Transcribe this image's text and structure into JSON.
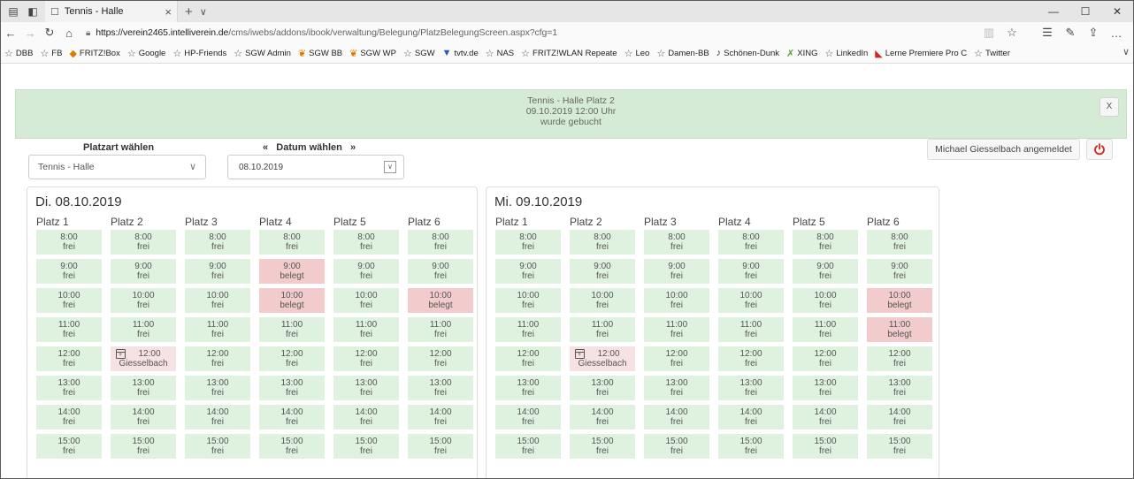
{
  "browser": {
    "tab_title": "Tennis - Halle",
    "url_host": "https://verein2465.intelliverein.de",
    "url_path": "/cms/iwebs/addons/ibook/verwaltung/Belegung/PlatzBelegungScreen.aspx?cfg=1",
    "favorites": [
      {
        "label": "DBB",
        "icon": "star-icon"
      },
      {
        "label": "FB",
        "icon": "star-icon"
      },
      {
        "label": "FRITZ!Box",
        "icon": "fritzbox-icon"
      },
      {
        "label": "Google",
        "icon": "star-icon"
      },
      {
        "label": "HP-Friends",
        "icon": "star-icon"
      },
      {
        "label": "SGW Admin",
        "icon": "star-icon"
      },
      {
        "label": "SGW BB",
        "icon": "sgw-icon"
      },
      {
        "label": "SGW WP",
        "icon": "sgw-icon"
      },
      {
        "label": "SGW",
        "icon": "star-icon"
      },
      {
        "label": "tvtv.de",
        "icon": "tvtv-icon"
      },
      {
        "label": "NAS",
        "icon": "star-icon"
      },
      {
        "label": "FRITZ!WLAN Repeate",
        "icon": "star-icon"
      },
      {
        "label": "Leo",
        "icon": "star-icon"
      },
      {
        "label": "Damen-BB",
        "icon": "star-icon"
      },
      {
        "label": "Schönen-Dunk",
        "icon": "dunk-icon"
      },
      {
        "label": "XING",
        "icon": "xing-icon"
      },
      {
        "label": "LinkedIn",
        "icon": "star-icon"
      },
      {
        "label": "Lerne Premiere Pro C",
        "icon": "adobe-icon"
      },
      {
        "label": "Twitter",
        "icon": "star-icon"
      }
    ]
  },
  "notice": {
    "line1": "Tennis - Halle Platz 2",
    "line2": "09.10.2019 12:00 Uhr",
    "line3": "wurde gebucht",
    "close": "X"
  },
  "controls": {
    "platzart_label": "Platzart wählen",
    "platzart_value": "Tennis - Halle",
    "datum_label": "Datum wählen",
    "prev": "«",
    "next": "»",
    "datum_value": "08.10.2019",
    "user": "Michael Giesselbach angemeldet"
  },
  "colors": {
    "free": "#dff2df",
    "belegt": "#f2cccc",
    "booked": "#f6e2e2",
    "notice": "#d6ebd6",
    "power": "#d9261c"
  },
  "days": [
    {
      "title": "Di. 08.10.2019",
      "courts": [
        {
          "name": "Platz 1",
          "slots": [
            [
              "8:00",
              "frei"
            ],
            [
              "9:00",
              "frei"
            ],
            [
              "10:00",
              "frei"
            ],
            [
              "11:00",
              "frei"
            ],
            [
              "12:00",
              "frei"
            ],
            [
              "13:00",
              "frei"
            ],
            [
              "14:00",
              "frei"
            ],
            [
              "15:00",
              "frei"
            ]
          ]
        },
        {
          "name": "Platz 2",
          "slots": [
            [
              "8:00",
              "frei"
            ],
            [
              "9:00",
              "frei"
            ],
            [
              "10:00",
              "frei"
            ],
            [
              "11:00",
              "frei"
            ],
            [
              "12:00",
              "Giesselbach"
            ],
            [
              "13:00",
              "frei"
            ],
            [
              "14:00",
              "frei"
            ],
            [
              "15:00",
              "frei"
            ]
          ]
        },
        {
          "name": "Platz 3",
          "slots": [
            [
              "8:00",
              "frei"
            ],
            [
              "9:00",
              "frei"
            ],
            [
              "10:00",
              "frei"
            ],
            [
              "11:00",
              "frei"
            ],
            [
              "12:00",
              "frei"
            ],
            [
              "13:00",
              "frei"
            ],
            [
              "14:00",
              "frei"
            ],
            [
              "15:00",
              "frei"
            ]
          ]
        },
        {
          "name": "Platz 4",
          "slots": [
            [
              "8:00",
              "frei"
            ],
            [
              "9:00",
              "belegt"
            ],
            [
              "10:00",
              "belegt"
            ],
            [
              "11:00",
              "frei"
            ],
            [
              "12:00",
              "frei"
            ],
            [
              "13:00",
              "frei"
            ],
            [
              "14:00",
              "frei"
            ],
            [
              "15:00",
              "frei"
            ]
          ]
        },
        {
          "name": "Platz 5",
          "slots": [
            [
              "8:00",
              "frei"
            ],
            [
              "9:00",
              "frei"
            ],
            [
              "10:00",
              "frei"
            ],
            [
              "11:00",
              "frei"
            ],
            [
              "12:00",
              "frei"
            ],
            [
              "13:00",
              "frei"
            ],
            [
              "14:00",
              "frei"
            ],
            [
              "15:00",
              "frei"
            ]
          ]
        },
        {
          "name": "Platz 6",
          "slots": [
            [
              "8:00",
              "frei"
            ],
            [
              "9:00",
              "frei"
            ],
            [
              "10:00",
              "belegt"
            ],
            [
              "11:00",
              "frei"
            ],
            [
              "12:00",
              "frei"
            ],
            [
              "13:00",
              "frei"
            ],
            [
              "14:00",
              "frei"
            ],
            [
              "15:00",
              "frei"
            ]
          ]
        }
      ]
    },
    {
      "title": "Mi. 09.10.2019",
      "courts": [
        {
          "name": "Platz 1",
          "slots": [
            [
              "8:00",
              "frei"
            ],
            [
              "9:00",
              "frei"
            ],
            [
              "10:00",
              "frei"
            ],
            [
              "11:00",
              "frei"
            ],
            [
              "12:00",
              "frei"
            ],
            [
              "13:00",
              "frei"
            ],
            [
              "14:00",
              "frei"
            ],
            [
              "15:00",
              "frei"
            ]
          ]
        },
        {
          "name": "Platz 2",
          "slots": [
            [
              "8:00",
              "frei"
            ],
            [
              "9:00",
              "frei"
            ],
            [
              "10:00",
              "frei"
            ],
            [
              "11:00",
              "frei"
            ],
            [
              "12:00",
              "Giesselbach"
            ],
            [
              "13:00",
              "frei"
            ],
            [
              "14:00",
              "frei"
            ],
            [
              "15:00",
              "frei"
            ]
          ]
        },
        {
          "name": "Platz 3",
          "slots": [
            [
              "8:00",
              "frei"
            ],
            [
              "9:00",
              "frei"
            ],
            [
              "10:00",
              "frei"
            ],
            [
              "11:00",
              "frei"
            ],
            [
              "12:00",
              "frei"
            ],
            [
              "13:00",
              "frei"
            ],
            [
              "14:00",
              "frei"
            ],
            [
              "15:00",
              "frei"
            ]
          ]
        },
        {
          "name": "Platz 4",
          "slots": [
            [
              "8:00",
              "frei"
            ],
            [
              "9:00",
              "frei"
            ],
            [
              "10:00",
              "frei"
            ],
            [
              "11:00",
              "frei"
            ],
            [
              "12:00",
              "frei"
            ],
            [
              "13:00",
              "frei"
            ],
            [
              "14:00",
              "frei"
            ],
            [
              "15:00",
              "frei"
            ]
          ]
        },
        {
          "name": "Platz 5",
          "slots": [
            [
              "8:00",
              "frei"
            ],
            [
              "9:00",
              "frei"
            ],
            [
              "10:00",
              "frei"
            ],
            [
              "11:00",
              "frei"
            ],
            [
              "12:00",
              "frei"
            ],
            [
              "13:00",
              "frei"
            ],
            [
              "14:00",
              "frei"
            ],
            [
              "15:00",
              "frei"
            ]
          ]
        },
        {
          "name": "Platz 6",
          "slots": [
            [
              "8:00",
              "frei"
            ],
            [
              "9:00",
              "frei"
            ],
            [
              "10:00",
              "belegt"
            ],
            [
              "11:00",
              "belegt"
            ],
            [
              "12:00",
              "frei"
            ],
            [
              "13:00",
              "frei"
            ],
            [
              "14:00",
              "frei"
            ],
            [
              "15:00",
              "frei"
            ]
          ]
        }
      ]
    }
  ]
}
